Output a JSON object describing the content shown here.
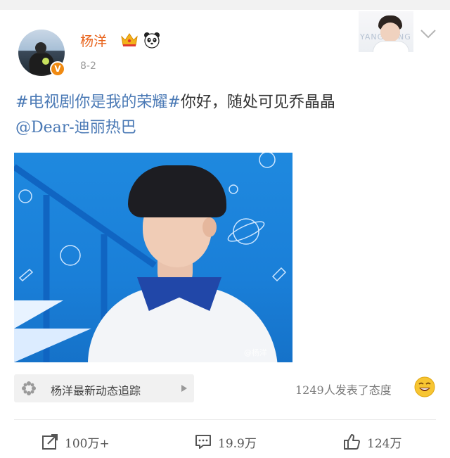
{
  "post": {
    "username": "杨洋",
    "date": "8-2",
    "verified_mark": "V",
    "follow_thumb_watermark": "YANG YANG",
    "text": {
      "hashtag": "#电视剧你是我的荣耀#",
      "body": "你好，随处可见乔晶晶",
      "mention": "@Dear-迪丽热巴"
    },
    "image": {
      "watermark": "@杨洋"
    }
  },
  "tracker": {
    "label": "杨洋最新动态追踪"
  },
  "reactions": {
    "summary": "1249人发表了态度"
  },
  "actions": {
    "share_count": "100万+",
    "comment_count": "19.9万",
    "like_count": "124万"
  },
  "colors": {
    "username": "#e8621a",
    "link": "#4a79b5",
    "verified_badge": "#f08a11",
    "image_bg": "#1a7fd8"
  },
  "icons": [
    "crown-icon",
    "panda-icon",
    "chevron-down-icon",
    "flower-icon",
    "caret-right-icon",
    "smile-icon",
    "share-icon",
    "comment-icon",
    "like-icon"
  ]
}
